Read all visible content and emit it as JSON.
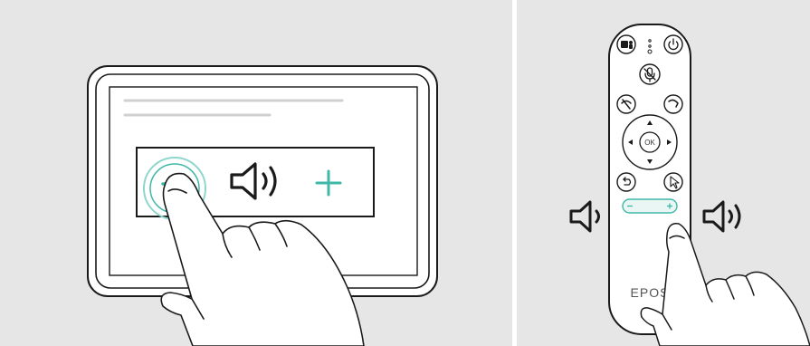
{
  "left_panel": {
    "touch_panel": {
      "controls": [
        {
          "icon": "minus-icon",
          "color": "#3fb8a8",
          "state": "pressed"
        },
        {
          "icon": "speaker-volume-icon",
          "color": "#1a1a1a"
        },
        {
          "icon": "plus-icon",
          "color": "#3fb8a8"
        }
      ]
    }
  },
  "right_panel": {
    "remote": {
      "brand": "EPOS",
      "ok_label": "OK",
      "buttons": [
        "teams-icon",
        "power-icon",
        "mute-mic-icon",
        "hang-up-icon",
        "answer-call-icon",
        "up-arrow-icon",
        "left-arrow-icon",
        "right-arrow-icon",
        "down-arrow-icon",
        "back-icon",
        "pointer-icon",
        "volume-rocker"
      ],
      "volume_rocker": {
        "minus": "−",
        "plus": "+",
        "accent": "#3fb8a8"
      }
    },
    "side_icons": [
      "speaker-low-icon",
      "speaker-high-icon"
    ]
  },
  "colors": {
    "background": "#e6e6e6",
    "accent": "#3fb8a8",
    "outline": "#1a1a1a"
  }
}
